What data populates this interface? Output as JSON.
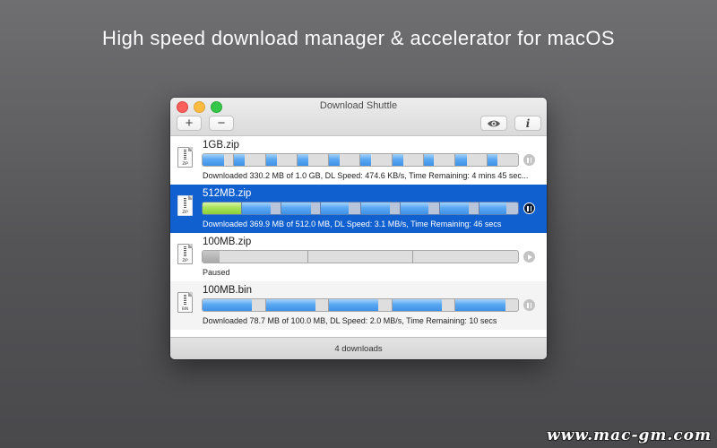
{
  "headline": "High speed download manager & accelerator for macOS",
  "watermark": "www.mac-gm.com",
  "window": {
    "title": "Download Shuttle",
    "toolbar": {
      "add_label": "+",
      "remove_label": "−",
      "eye_icon": "eye-icon",
      "info_label": "i"
    },
    "footer": "4 downloads"
  },
  "colors": {
    "selection": "#1060cf",
    "progress_blue": "#4a9cef",
    "progress_green": "#9fdc4c"
  },
  "downloads": [
    {
      "filename": "1GB.zip",
      "icon_label": "ZIP",
      "status": "Downloaded 330.2 MB of 1.0 GB, DL Speed: 474.6 KB/s, Time Remaining: 4 mins 45 sec...",
      "control": "pause",
      "selected": false,
      "segments": [
        0.71,
        0.33,
        0.36,
        0.36,
        0.34,
        0.33,
        0.36,
        0.33,
        0.36,
        0.33
      ]
    },
    {
      "filename": "512MB.zip",
      "icon_label": "ZIP",
      "status": "Downloaded 369.9 MB of 512.0 MB, DL Speed: 3.1 MB/s, Time Remaining: 46 secs",
      "control": "pause",
      "selected": true,
      "segments": [
        1.0,
        0.74,
        0.77,
        0.72,
        0.75,
        0.72,
        0.74,
        0.7
      ]
    },
    {
      "filename": "100MB.zip",
      "icon_label": "ZIP",
      "status": "Paused",
      "control": "play",
      "selected": false,
      "segments": [
        0.16,
        0.0,
        0.0
      ]
    },
    {
      "filename": "100MB.bin",
      "icon_label": "BIN",
      "status": "Downloaded 78.7 MB of 100.0 MB, DL Speed: 2.0 MB/s, Time Remaining: 10 secs",
      "control": "pause",
      "selected": false,
      "segments": [
        0.79,
        0.79,
        0.79,
        0.79,
        0.8
      ]
    }
  ]
}
